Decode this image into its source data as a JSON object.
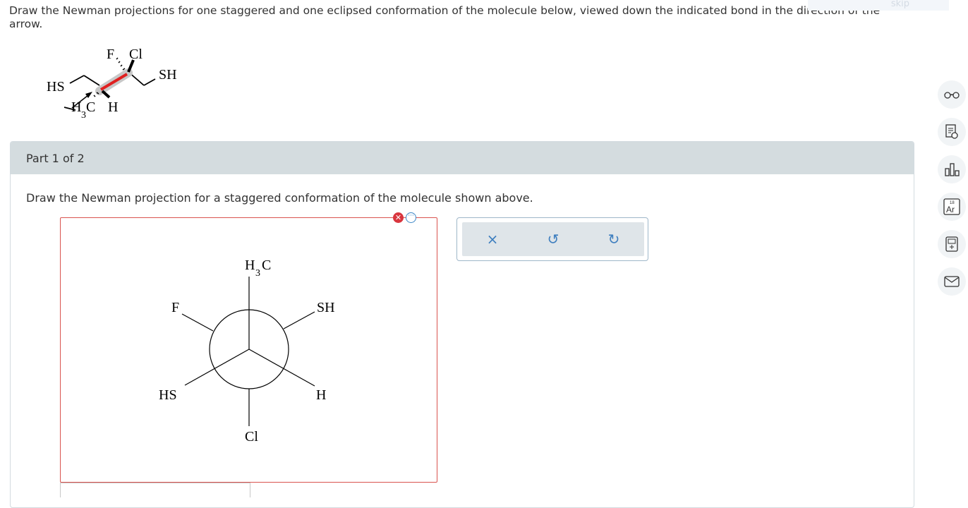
{
  "question": {
    "text": "Draw the Newman projections for one staggered and one eclipsed conformation of the molecule below, viewed down the indicated bond in the direction of the arrow."
  },
  "top_hint": {
    "label": "skip"
  },
  "molecule": {
    "labels": {
      "f": "F",
      "cl": "Cl",
      "sh": "SH",
      "hs": "HS",
      "h3c_h": "H",
      "h3c_sub": "3",
      "h3c_c": "C",
      "h": "H"
    },
    "highlight_bond_color": "#e02020"
  },
  "part": {
    "header": "Part 1 of 2",
    "prompt": "Draw the Newman projection for a staggered conformation of the molecule shown above."
  },
  "status_icons": {
    "error": "error-icon",
    "more": "more-options-icon"
  },
  "newman": {
    "front_top_h": "H",
    "front_top_sub": "3",
    "front_top_c": "C",
    "front_lower_left": "HS",
    "front_lower_right": "H",
    "back_upper_left": "F",
    "back_upper_right": "SH",
    "back_bottom": "Cl"
  },
  "toolbox": {
    "tools": [
      {
        "name": "clear",
        "icon": "close-icon",
        "symbol": "×"
      },
      {
        "name": "undo",
        "icon": "undo-icon",
        "symbol": "↺"
      },
      {
        "name": "redo",
        "icon": "redo-icon",
        "symbol": "↻"
      }
    ]
  },
  "sidebar": {
    "items": [
      {
        "icon": "reading-glasses-icon"
      },
      {
        "icon": "worksheet-icon"
      },
      {
        "icon": "bar-chart-icon"
      },
      {
        "icon": "periodic-table-icon",
        "top_num": "18",
        "symbol": "Ar"
      },
      {
        "icon": "calculator-icon"
      },
      {
        "icon": "mail-icon"
      }
    ]
  },
  "colors": {
    "accent": "#3f7fbf",
    "error": "#d9363e",
    "header_bg": "#d4dcdf"
  }
}
